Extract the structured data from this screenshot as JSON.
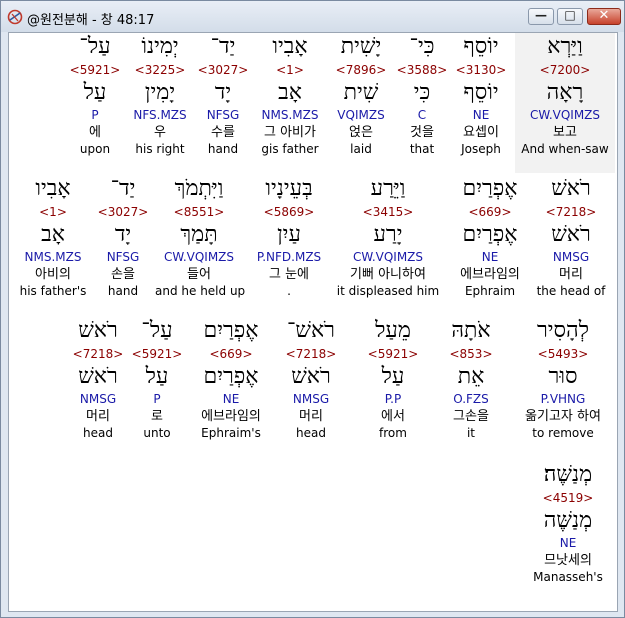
{
  "window": {
    "title": "@원전분해 - 창 48:17",
    "min_glyph": "—",
    "max_glyph": "□",
    "close_glyph": "✕"
  },
  "rows": [
    {
      "words": [
        {
          "hebrew": "וַיַּרְא",
          "strong": "<7200>",
          "lemma": "רָאָה",
          "morph": "CW.VQIMZS",
          "korean": "보고",
          "english": "And when-saw",
          "highlight": true
        },
        {
          "hebrew": "יוֹסֵף",
          "strong": "<3130>",
          "lemma": "יוֹסֵף",
          "morph": "NE",
          "korean": "요셉이",
          "english": "Joseph"
        },
        {
          "hebrew": "כִּי־",
          "strong": "<3588>",
          "lemma": "כִּי",
          "morph": "C",
          "korean": "것을",
          "english": "that"
        },
        {
          "hebrew": "יָשִׁית",
          "strong": "<7896>",
          "lemma": "שִׁית",
          "morph": "VQIMZS",
          "korean": "얹은",
          "english": "laid"
        },
        {
          "hebrew": "אָבִיו",
          "strong": "<1>",
          "lemma": "אָב",
          "morph": "NMS.MZS",
          "korean": "그 아비가",
          "english": "gis father"
        },
        {
          "hebrew": "יַד־",
          "strong": "<3027>",
          "lemma": "יָד",
          "morph": "NFSG",
          "korean": "수를",
          "english": "hand"
        },
        {
          "hebrew": "יְמִינוֹ",
          "strong": "<3225>",
          "lemma": "יָמִין",
          "morph": "NFS.MZS",
          "korean": "우",
          "english": "his right"
        },
        {
          "hebrew": "עַל־",
          "strong": "<5921>",
          "lemma": "עַל",
          "morph": "P",
          "korean": "에",
          "english": "upon"
        }
      ]
    },
    {
      "words": [
        {
          "hebrew": "רֹאשׁ",
          "strong": "<7218>",
          "lemma": "רֹאשׁ",
          "morph": "NMSG",
          "korean": "머리",
          "english": "the head of"
        },
        {
          "hebrew": "אֶפְרַיִם",
          "strong": "<669>",
          "lemma": "אֶפְרַיִם",
          "morph": "NE",
          "korean": "에브라임의",
          "english": "Ephraim"
        },
        {
          "hebrew": "וַיֵּרַע",
          "strong": "<3415>",
          "lemma": "יָרַע",
          "morph": "CW.VQIMZS",
          "korean": "기뻐 아니하여",
          "english": "it displeased him"
        },
        {
          "hebrew": "בְּעֵינָיו",
          "strong": "<5869>",
          "lemma": "עַיִן",
          "morph": "P.NFD.MZS",
          "korean": "그 눈에",
          "english": "."
        },
        {
          "hebrew": "וַיִּתְמֹךְ",
          "strong": "<8551>",
          "lemma": "תָּמַךְ",
          "morph": "CW.VQIMZS",
          "korean": "들어",
          "english": "and he held up"
        },
        {
          "hebrew": "יַד־",
          "strong": "<3027>",
          "lemma": "יָד",
          "morph": "NFSG",
          "korean": "손을",
          "english": "hand"
        },
        {
          "hebrew": "אָבִיו",
          "strong": "<1>",
          "lemma": "אָב",
          "morph": "NMS.MZS",
          "korean": "아비의",
          "english": "his father's"
        }
      ]
    },
    {
      "words": [
        {
          "hebrew": "לְהָסִיר",
          "strong": "<5493>",
          "lemma": "סוּר",
          "morph": "P.VHNG",
          "korean": "옮기고자 하여",
          "english": "to remove"
        },
        {
          "hebrew": "אֹתָהּ",
          "strong": "<853>",
          "lemma": "אֵת",
          "morph": "O.FZS",
          "korean": "그손을",
          "english": "it"
        },
        {
          "hebrew": "מֵעַל",
          "strong": "<5921>",
          "lemma": "עַל",
          "morph": "P.P",
          "korean": "에서",
          "english": "from"
        },
        {
          "hebrew": "רֹאשׁ־",
          "strong": "<7218>",
          "lemma": "רֹאשׁ",
          "morph": "NMSG",
          "korean": "머리",
          "english": "head"
        },
        {
          "hebrew": "אֶפְרַיִם",
          "strong": "<669>",
          "lemma": "אֶפְרַיִם",
          "morph": "NE",
          "korean": "에브라임의",
          "english": "Ephraim's"
        },
        {
          "hebrew": "עַל־",
          "strong": "<5921>",
          "lemma": "עַל",
          "morph": "P",
          "korean": "로",
          "english": "unto"
        },
        {
          "hebrew": "רֹאשׁ",
          "strong": "<7218>",
          "lemma": "רֹאשׁ",
          "morph": "NMSG",
          "korean": "머리",
          "english": "head"
        }
      ]
    },
    {
      "words": [
        {
          "hebrew": "מְנַשֶּׁה׃",
          "strong": "<4519>",
          "lemma": "מְנַשֶּׁה",
          "morph": "NE",
          "korean": "므낫세의",
          "english": "Manasseh's"
        }
      ]
    }
  ]
}
